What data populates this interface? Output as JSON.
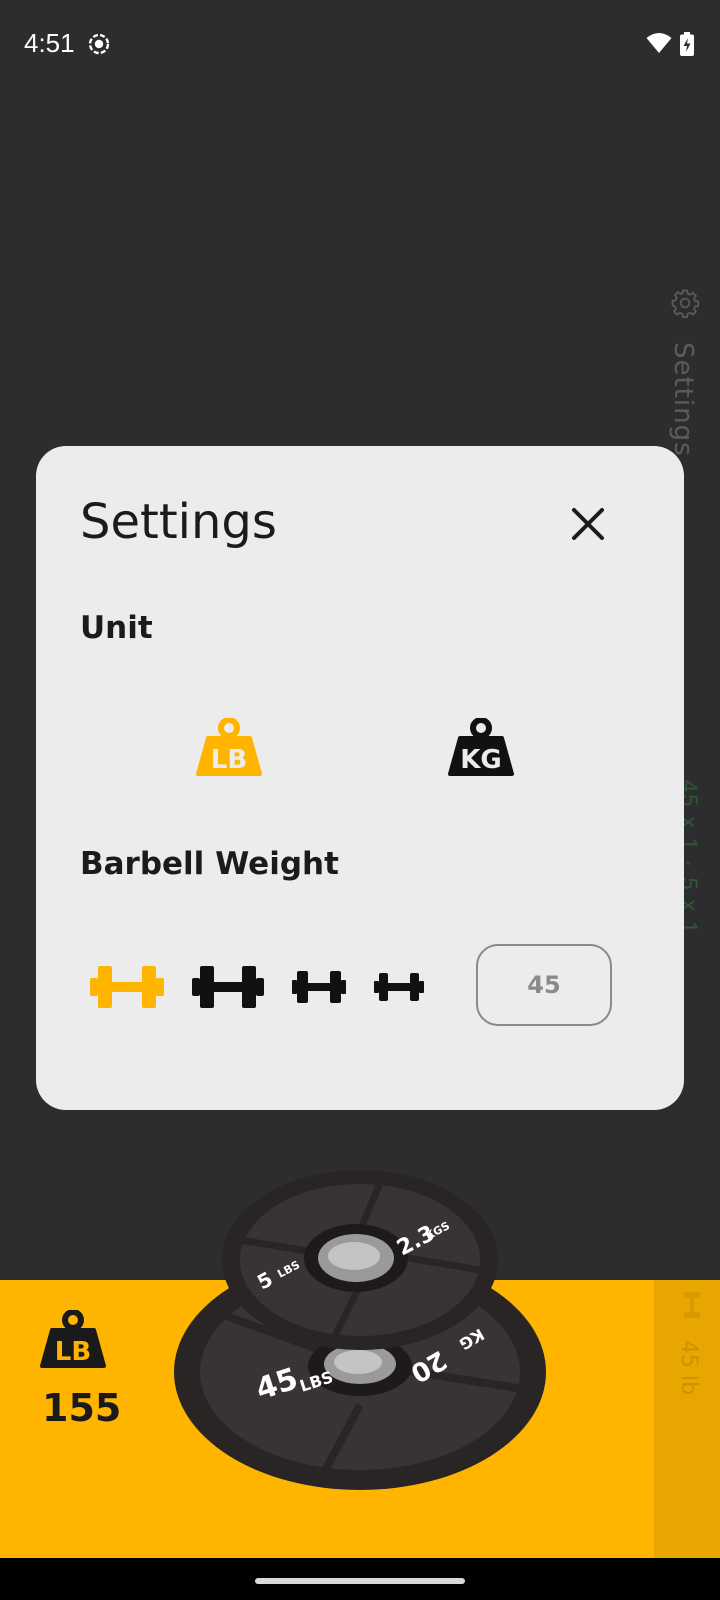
{
  "status": {
    "time": "4:51"
  },
  "background": {
    "side_settings_label": "Settings",
    "side_green_text": "45 x 1 · 5 x 1",
    "strip_label": "45 lb"
  },
  "dialog": {
    "title": "Settings",
    "unit_label": "Unit",
    "unit_options": [
      {
        "name": "pounds",
        "text": "LB",
        "selected": true
      },
      {
        "name": "kilograms",
        "text": "KG",
        "selected": false
      }
    ],
    "barbell_label": "Barbell Weight",
    "barbell_options": [
      "olympic",
      "standard",
      "short",
      "mini"
    ],
    "selected_barbell": "olympic",
    "barbell_weight_value": "45"
  },
  "total": {
    "unit_icon_text": "LB",
    "value": "155"
  },
  "plates": {
    "back_plate": {
      "value": "45",
      "unit": "LBS",
      "kg_value": "20",
      "kg_unit": "KG"
    },
    "front_plate": {
      "value": "5",
      "unit": "LBS",
      "kg_value": "2.3",
      "kg_unit": "KGS"
    }
  },
  "colors": {
    "accent": "#ffb400",
    "dialog_bg": "#ececec",
    "app_bg": "#2d2d2f",
    "icon_dark": "#111111"
  }
}
